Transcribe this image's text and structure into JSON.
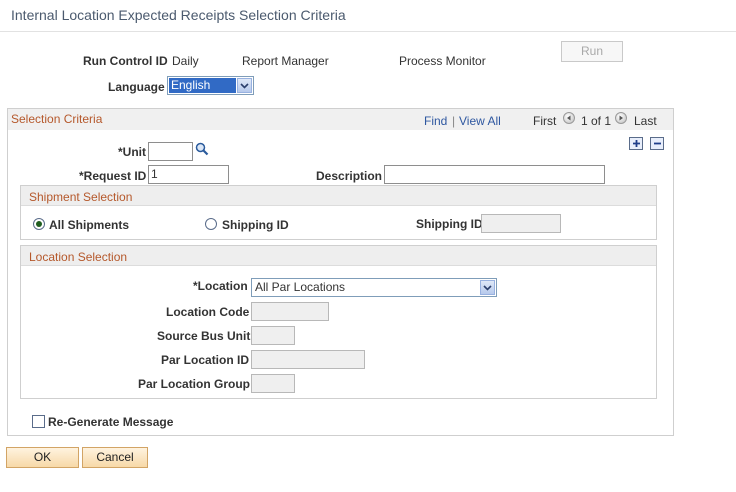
{
  "page": {
    "title": "Internal Location Expected Receipts Selection Criteria"
  },
  "header": {
    "run_control_label": "Run Control ID",
    "run_control_value": "Daily",
    "report_manager": "Report Manager",
    "process_monitor": "Process Monitor",
    "run_button": "Run",
    "language_label": "Language",
    "language_value": "English"
  },
  "selection_criteria": {
    "title": "Selection Criteria",
    "find": "Find",
    "separator": "|",
    "view_all": "View All",
    "first": "First",
    "page_indicator": "1 of 1",
    "last": "Last",
    "unit_label": "*Unit",
    "unit_value": "",
    "request_id_label": "*Request ID",
    "request_id_value": "1",
    "description_label": "Description",
    "description_value": ""
  },
  "shipment_selection": {
    "title": "Shipment Selection",
    "all_shipments": "All Shipments",
    "shipping_id_radio": "Shipping ID",
    "shipping_id_label": "Shipping ID",
    "selected": "All Shipments"
  },
  "location_selection": {
    "title": "Location Selection",
    "location_label": "*Location",
    "location_value": "All Par Locations",
    "location_code_label": "Location Code",
    "source_bus_unit_label": "Source Bus Unit",
    "par_location_id_label": "Par Location ID",
    "par_location_group_label": "Par Location Group"
  },
  "regenerate": {
    "label": "Re-Generate Message",
    "checked": false
  },
  "footer": {
    "ok": "OK",
    "cancel": "Cancel"
  },
  "colors": {
    "section_title": "#b5582b",
    "link": "#2e57a0",
    "button": "#f7d9a8"
  }
}
